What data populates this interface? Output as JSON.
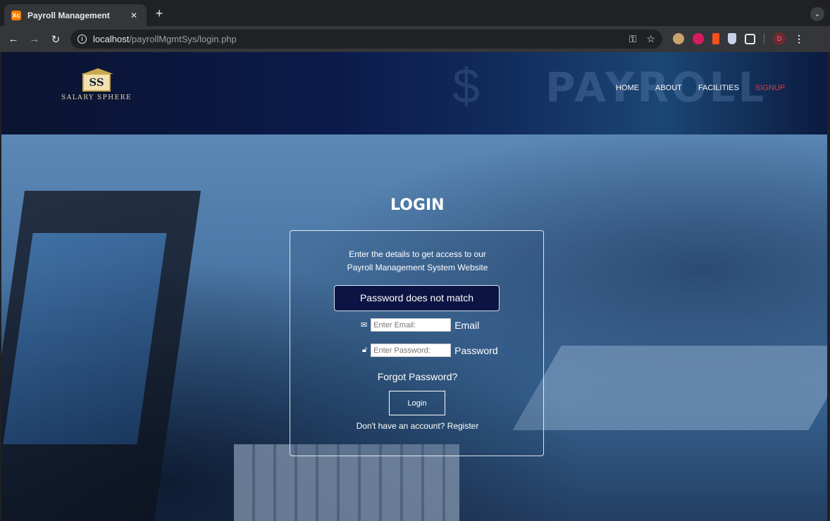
{
  "browser": {
    "tab_title": "Payroll Management",
    "favicon_label": "Xc",
    "new_tab": "+",
    "url_host": "localhost",
    "url_path": "/payrollMgmtSys/login.php",
    "profile_initial": "D"
  },
  "site": {
    "logo_mark": "SS",
    "logo_text": "SALARY SPHERE",
    "header_bg_text": "PAYROLL",
    "nav": [
      {
        "label": "HOME"
      },
      {
        "label": "ABOUT"
      },
      {
        "label": "FACILITIES"
      },
      {
        "label": "SIGNUP"
      }
    ],
    "accent_color": "#e53935"
  },
  "login": {
    "title": "LOGIN",
    "intro_line1": "Enter the details to get access to our",
    "intro_line2": "Payroll Management System Website",
    "alert": "Password does not match",
    "email_placeholder": "Enter Email:",
    "email_label": "Email",
    "password_placeholder": "Enter Password:",
    "password_label": "Password",
    "forgot": "Forgot Password?",
    "login_button": "Login",
    "register_prompt": "Don't have an account? Register"
  }
}
